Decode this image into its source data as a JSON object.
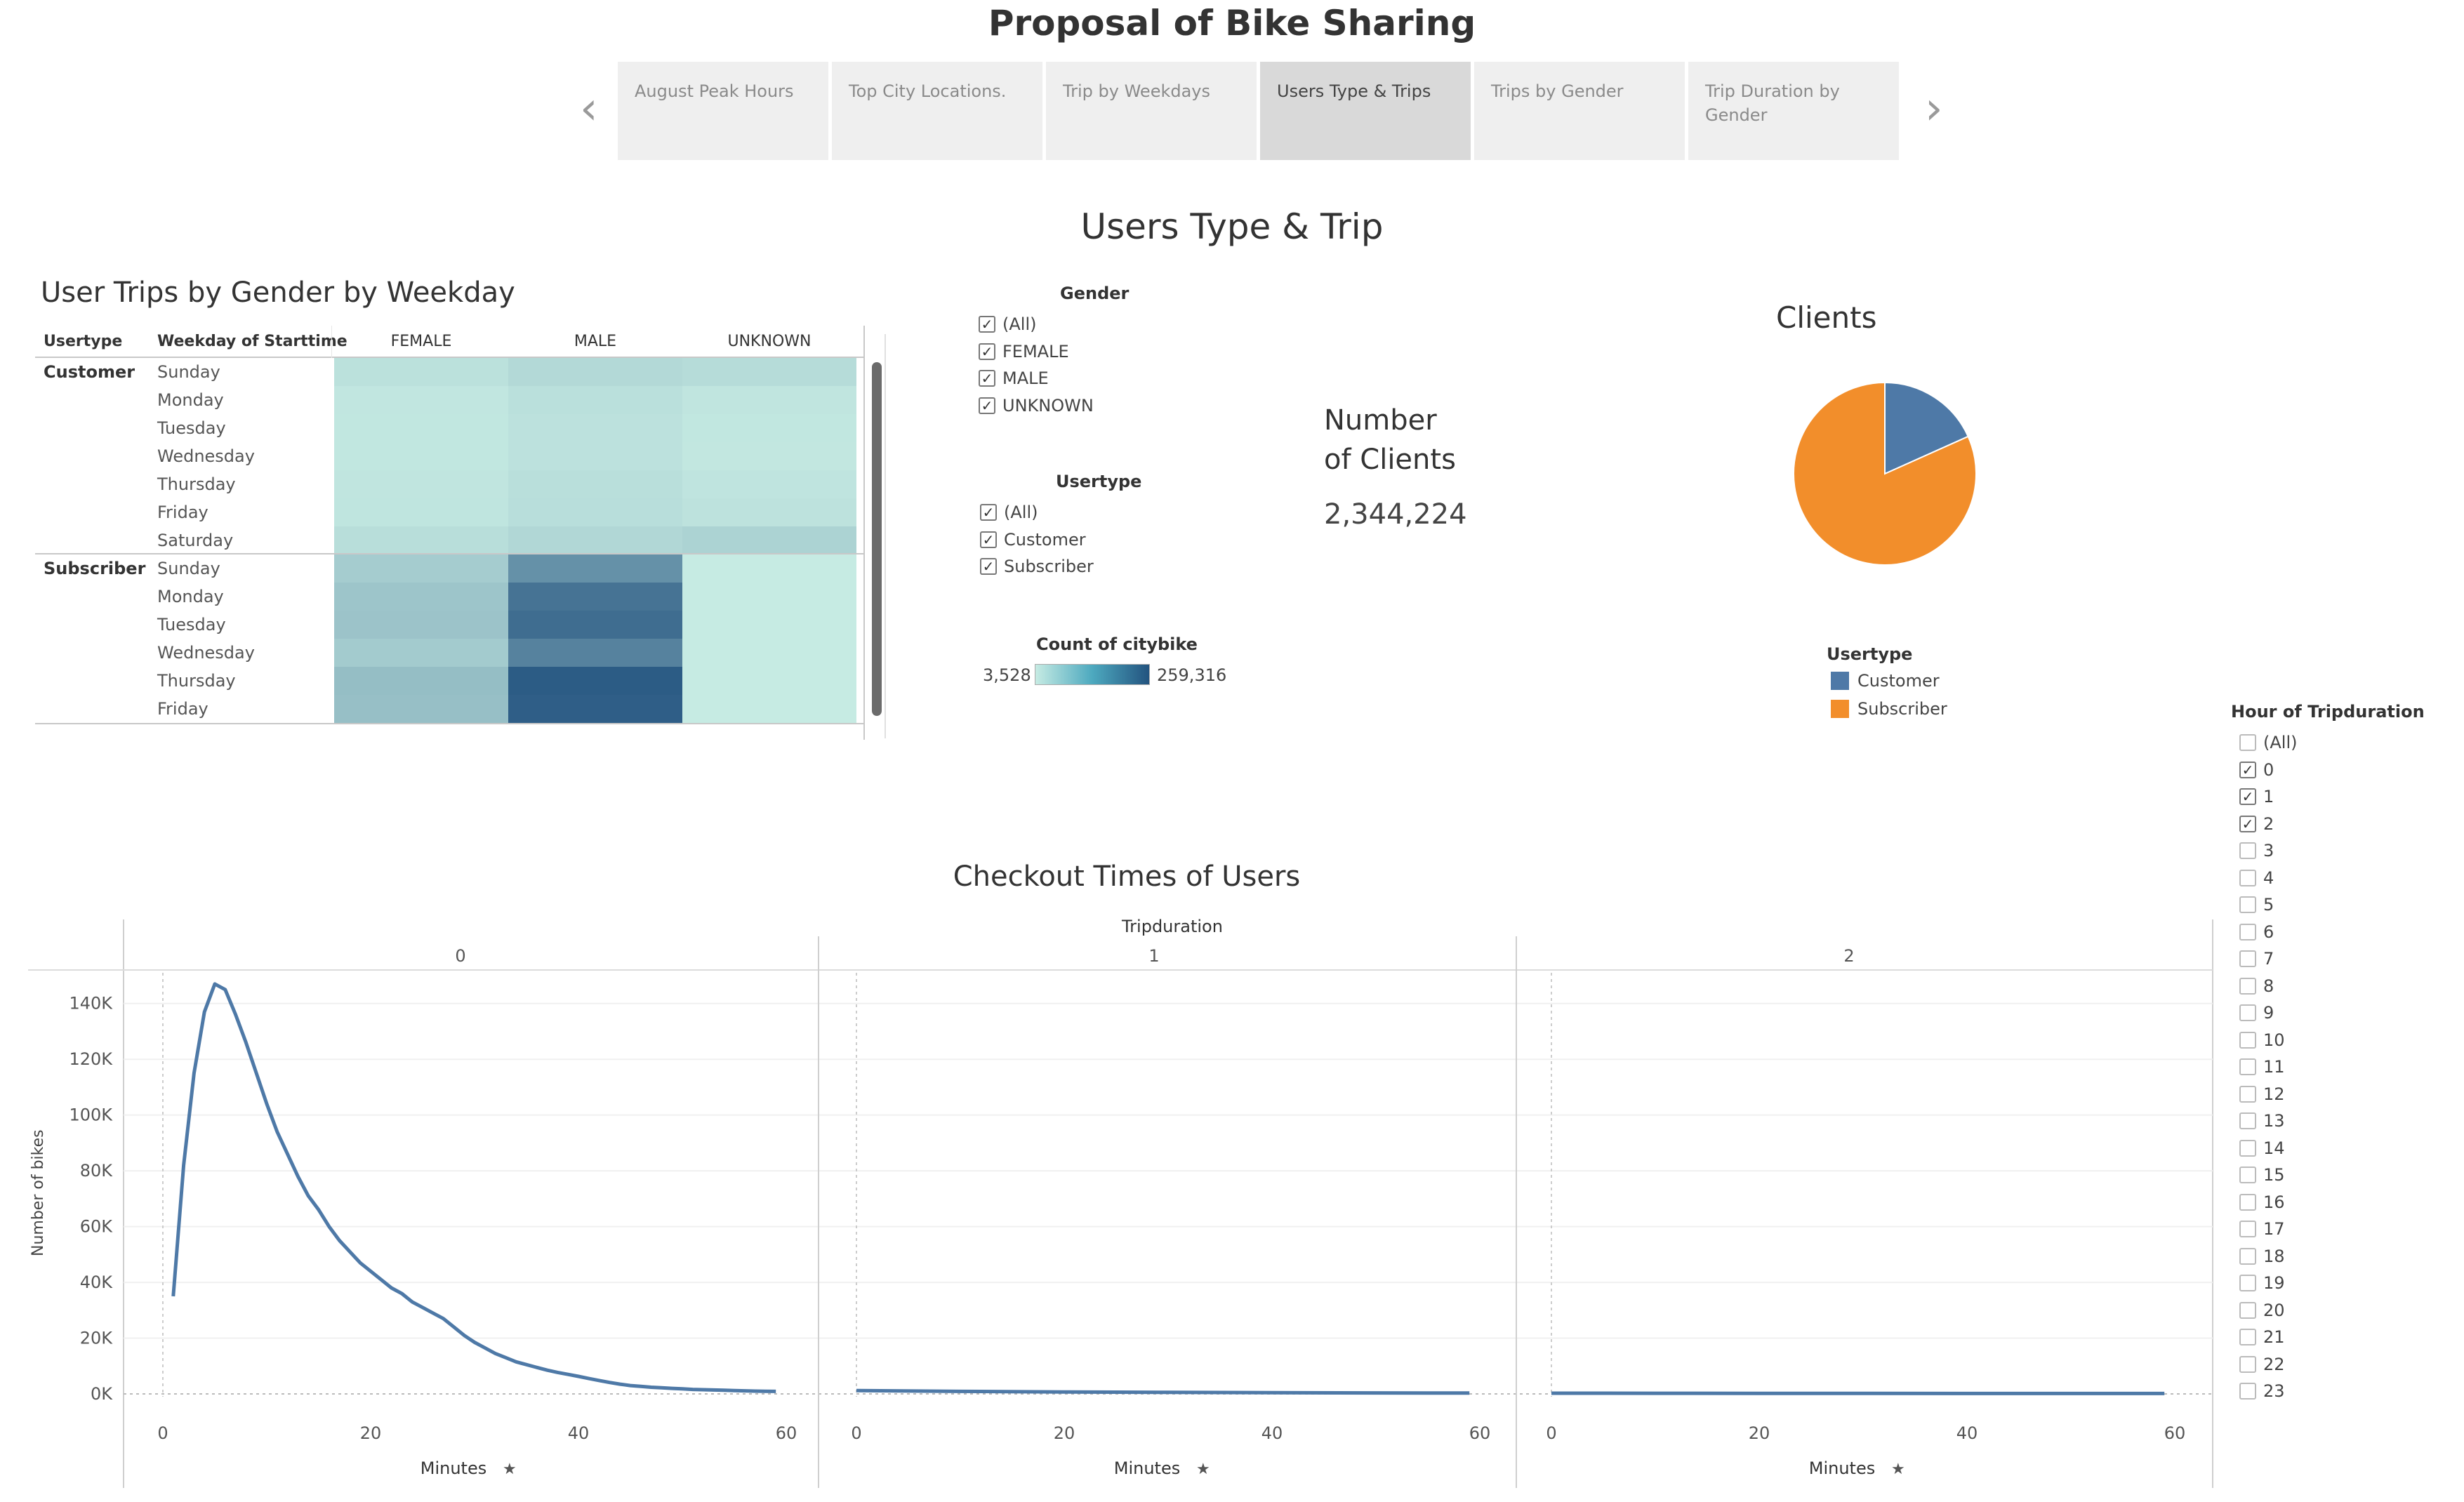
{
  "story": {
    "title": "Proposal of Bike Sharing",
    "tabs": [
      {
        "line1": "August Peak Hours",
        "line2": ""
      },
      {
        "line1": "Top City Locations.",
        "line2": ""
      },
      {
        "line1": "Trip by Weekdays",
        "line2": ""
      },
      {
        "line1": "Users Type & Trips",
        "line2": ""
      },
      {
        "line1": "Trips by Gender",
        "line2": ""
      },
      {
        "line1": "Trip Duration by",
        "line2": "Gender"
      }
    ],
    "active_tab": 3
  },
  "dashboard_title": "Users Type & Trip",
  "heatmap": {
    "title": "User Trips by Gender by Weekday",
    "row_header_1": "Usertype",
    "row_header_2": "Weekday of Starttime",
    "columns": [
      "FEMALE",
      "MALE",
      "UNKNOWN"
    ],
    "groups": [
      {
        "usertype": "Customer",
        "days": [
          "Sunday",
          "Monday",
          "Tuesday",
          "Wednesday",
          "Thursday",
          "Friday",
          "Saturday"
        ]
      },
      {
        "usertype": "Subscriber",
        "days": [
          "Sunday",
          "Monday",
          "Tuesday",
          "Wednesday",
          "Thursday",
          "Friday"
        ]
      }
    ]
  },
  "gender_filter": {
    "title": "Gender",
    "items": [
      {
        "label": "(All)",
        "checked": true
      },
      {
        "label": "FEMALE",
        "checked": true
      },
      {
        "label": "MALE",
        "checked": true
      },
      {
        "label": "UNKNOWN",
        "checked": true
      }
    ]
  },
  "usertype_filter": {
    "title": "Usertype",
    "items": [
      {
        "label": "(All)",
        "checked": true
      },
      {
        "label": "Customer",
        "checked": true
      },
      {
        "label": "Subscriber",
        "checked": true
      }
    ]
  },
  "color_legend": {
    "title": "Count of citybike",
    "min": "3,528",
    "max": "259,316",
    "color_low": "#c6ebe3",
    "color_high": "#23537f"
  },
  "kpi": {
    "label_line1": "Number",
    "label_line2": "of Clients",
    "value": "2,344,224"
  },
  "clients_pie": {
    "title": "Clients",
    "legend_title": "Usertype",
    "slices": [
      {
        "label": "Customer",
        "share": 0.183,
        "color": "#4e79a7"
      },
      {
        "label": "Subscriber",
        "share": 0.817,
        "color": "#f28e2b"
      }
    ]
  },
  "hour_filter": {
    "title": "Hour of Tripduration",
    "items": [
      {
        "label": "(All)",
        "checked": false
      },
      {
        "label": "0",
        "checked": true
      },
      {
        "label": "1",
        "checked": true
      },
      {
        "label": "2",
        "checked": true
      },
      {
        "label": "3",
        "checked": false
      },
      {
        "label": "4",
        "checked": false
      },
      {
        "label": "5",
        "checked": false
      },
      {
        "label": "6",
        "checked": false
      },
      {
        "label": "7",
        "checked": false
      },
      {
        "label": "8",
        "checked": false
      },
      {
        "label": "9",
        "checked": false
      },
      {
        "label": "10",
        "checked": false
      },
      {
        "label": "11",
        "checked": false
      },
      {
        "label": "12",
        "checked": false
      },
      {
        "label": "13",
        "checked": false
      },
      {
        "label": "14",
        "checked": false
      },
      {
        "label": "15",
        "checked": false
      },
      {
        "label": "16",
        "checked": false
      },
      {
        "label": "17",
        "checked": false
      },
      {
        "label": "18",
        "checked": false
      },
      {
        "label": "19",
        "checked": false
      },
      {
        "label": "20",
        "checked": false
      },
      {
        "label": "21",
        "checked": false
      },
      {
        "label": "22",
        "checked": false
      },
      {
        "label": "23",
        "checked": false
      }
    ]
  },
  "checkout": {
    "title": "Checkout Times of Users",
    "panel_header": "Tripduration",
    "ylabel": "Number of bikes",
    "xlabel": "Minutes"
  },
  "chart_data": {
    "type": "line",
    "title": "Checkout Times of Users",
    "xlabel": "Minutes",
    "ylabel": "Number of bikes",
    "facet_label": "Tripduration",
    "facets": [
      "0",
      "1",
      "2"
    ],
    "ylim": [
      0,
      150000
    ],
    "yticks": [
      0,
      20000,
      40000,
      60000,
      80000,
      100000,
      120000,
      140000
    ],
    "ytick_labels": [
      "0K",
      "20K",
      "40K",
      "60K",
      "80K",
      "100K",
      "120K",
      "140K"
    ],
    "xlim": [
      0,
      60
    ],
    "xticks": [
      0,
      20,
      40,
      60
    ],
    "line_color": "#4e79a7",
    "series": [
      {
        "facet": "0",
        "x": [
          1,
          2,
          3,
          4,
          5,
          6,
          7,
          8,
          9,
          10,
          11,
          12,
          13,
          14,
          15,
          16,
          17,
          18,
          19,
          20,
          21,
          22,
          23,
          24,
          25,
          26,
          27,
          28,
          29,
          30,
          31,
          32,
          33,
          34,
          35,
          36,
          37,
          38,
          39,
          40,
          41,
          42,
          43,
          44,
          45,
          46,
          47,
          48,
          49,
          50,
          51,
          52,
          53,
          54,
          55,
          56,
          57,
          58,
          59
        ],
        "y": [
          35000,
          82000,
          115000,
          137000,
          147000,
          145000,
          136000,
          126000,
          115000,
          104000,
          94000,
          86000,
          78000,
          71000,
          66000,
          60000,
          55000,
          51000,
          47000,
          44000,
          41000,
          38000,
          36000,
          33000,
          31000,
          29000,
          27000,
          24000,
          21000,
          18500,
          16500,
          14500,
          13000,
          11500,
          10500,
          9500,
          8500,
          7700,
          7000,
          6300,
          5500,
          4800,
          4100,
          3500,
          3000,
          2700,
          2400,
          2200,
          2000,
          1800,
          1600,
          1500,
          1400,
          1300,
          1200,
          1100,
          1000,
          950,
          900
        ]
      },
      {
        "facet": "1",
        "x": [
          0,
          10,
          20,
          30,
          40,
          50,
          59
        ],
        "y": [
          1200,
          900,
          700,
          550,
          450,
          350,
          300
        ]
      },
      {
        "facet": "2",
        "x": [
          0,
          10,
          20,
          30,
          40,
          50,
          59
        ],
        "y": [
          250,
          220,
          200,
          180,
          160,
          150,
          140
        ]
      }
    ]
  },
  "heatmap_data": {
    "type": "heatmap",
    "title": "User Trips by Gender by Weekday",
    "columns": [
      "FEMALE",
      "MALE",
      "UNKNOWN"
    ],
    "rows": [
      {
        "usertype": "Customer",
        "weekday": "Sunday",
        "values": [
          21000,
          33000,
          28000
        ]
      },
      {
        "usertype": "Customer",
        "weekday": "Monday",
        "values": [
          12000,
          22000,
          13000
        ]
      },
      {
        "usertype": "Customer",
        "weekday": "Tuesday",
        "values": [
          11000,
          20000,
          11000
        ]
      },
      {
        "usertype": "Customer",
        "weekday": "Wednesday",
        "values": [
          11000,
          20000,
          10000
        ]
      },
      {
        "usertype": "Customer",
        "weekday": "Thursday",
        "values": [
          13000,
          24000,
          15000
        ]
      },
      {
        "usertype": "Customer",
        "weekday": "Friday",
        "values": [
          14000,
          25000,
          18000
        ]
      },
      {
        "usertype": "Customer",
        "weekday": "Saturday",
        "values": [
          26000,
          37000,
          44000
        ]
      },
      {
        "usertype": "Subscriber",
        "weekday": "Sunday",
        "values": [
          55000,
          155000,
          3528
        ]
      },
      {
        "usertype": "Subscriber",
        "weekday": "Monday",
        "values": [
          68000,
          205000,
          3600
        ]
      },
      {
        "usertype": "Subscriber",
        "weekday": "Tuesday",
        "values": [
          70000,
          215000,
          3700
        ]
      },
      {
        "usertype": "Subscriber",
        "weekday": "Wednesday",
        "values": [
          58000,
          180000,
          3600
        ]
      },
      {
        "usertype": "Subscriber",
        "weekday": "Thursday",
        "values": [
          80000,
          245000,
          3800
        ]
      },
      {
        "usertype": "Subscriber",
        "weekday": "Friday",
        "values": [
          78000,
          240000,
          3700
        ]
      }
    ],
    "min": 3528,
    "max": 259316
  }
}
